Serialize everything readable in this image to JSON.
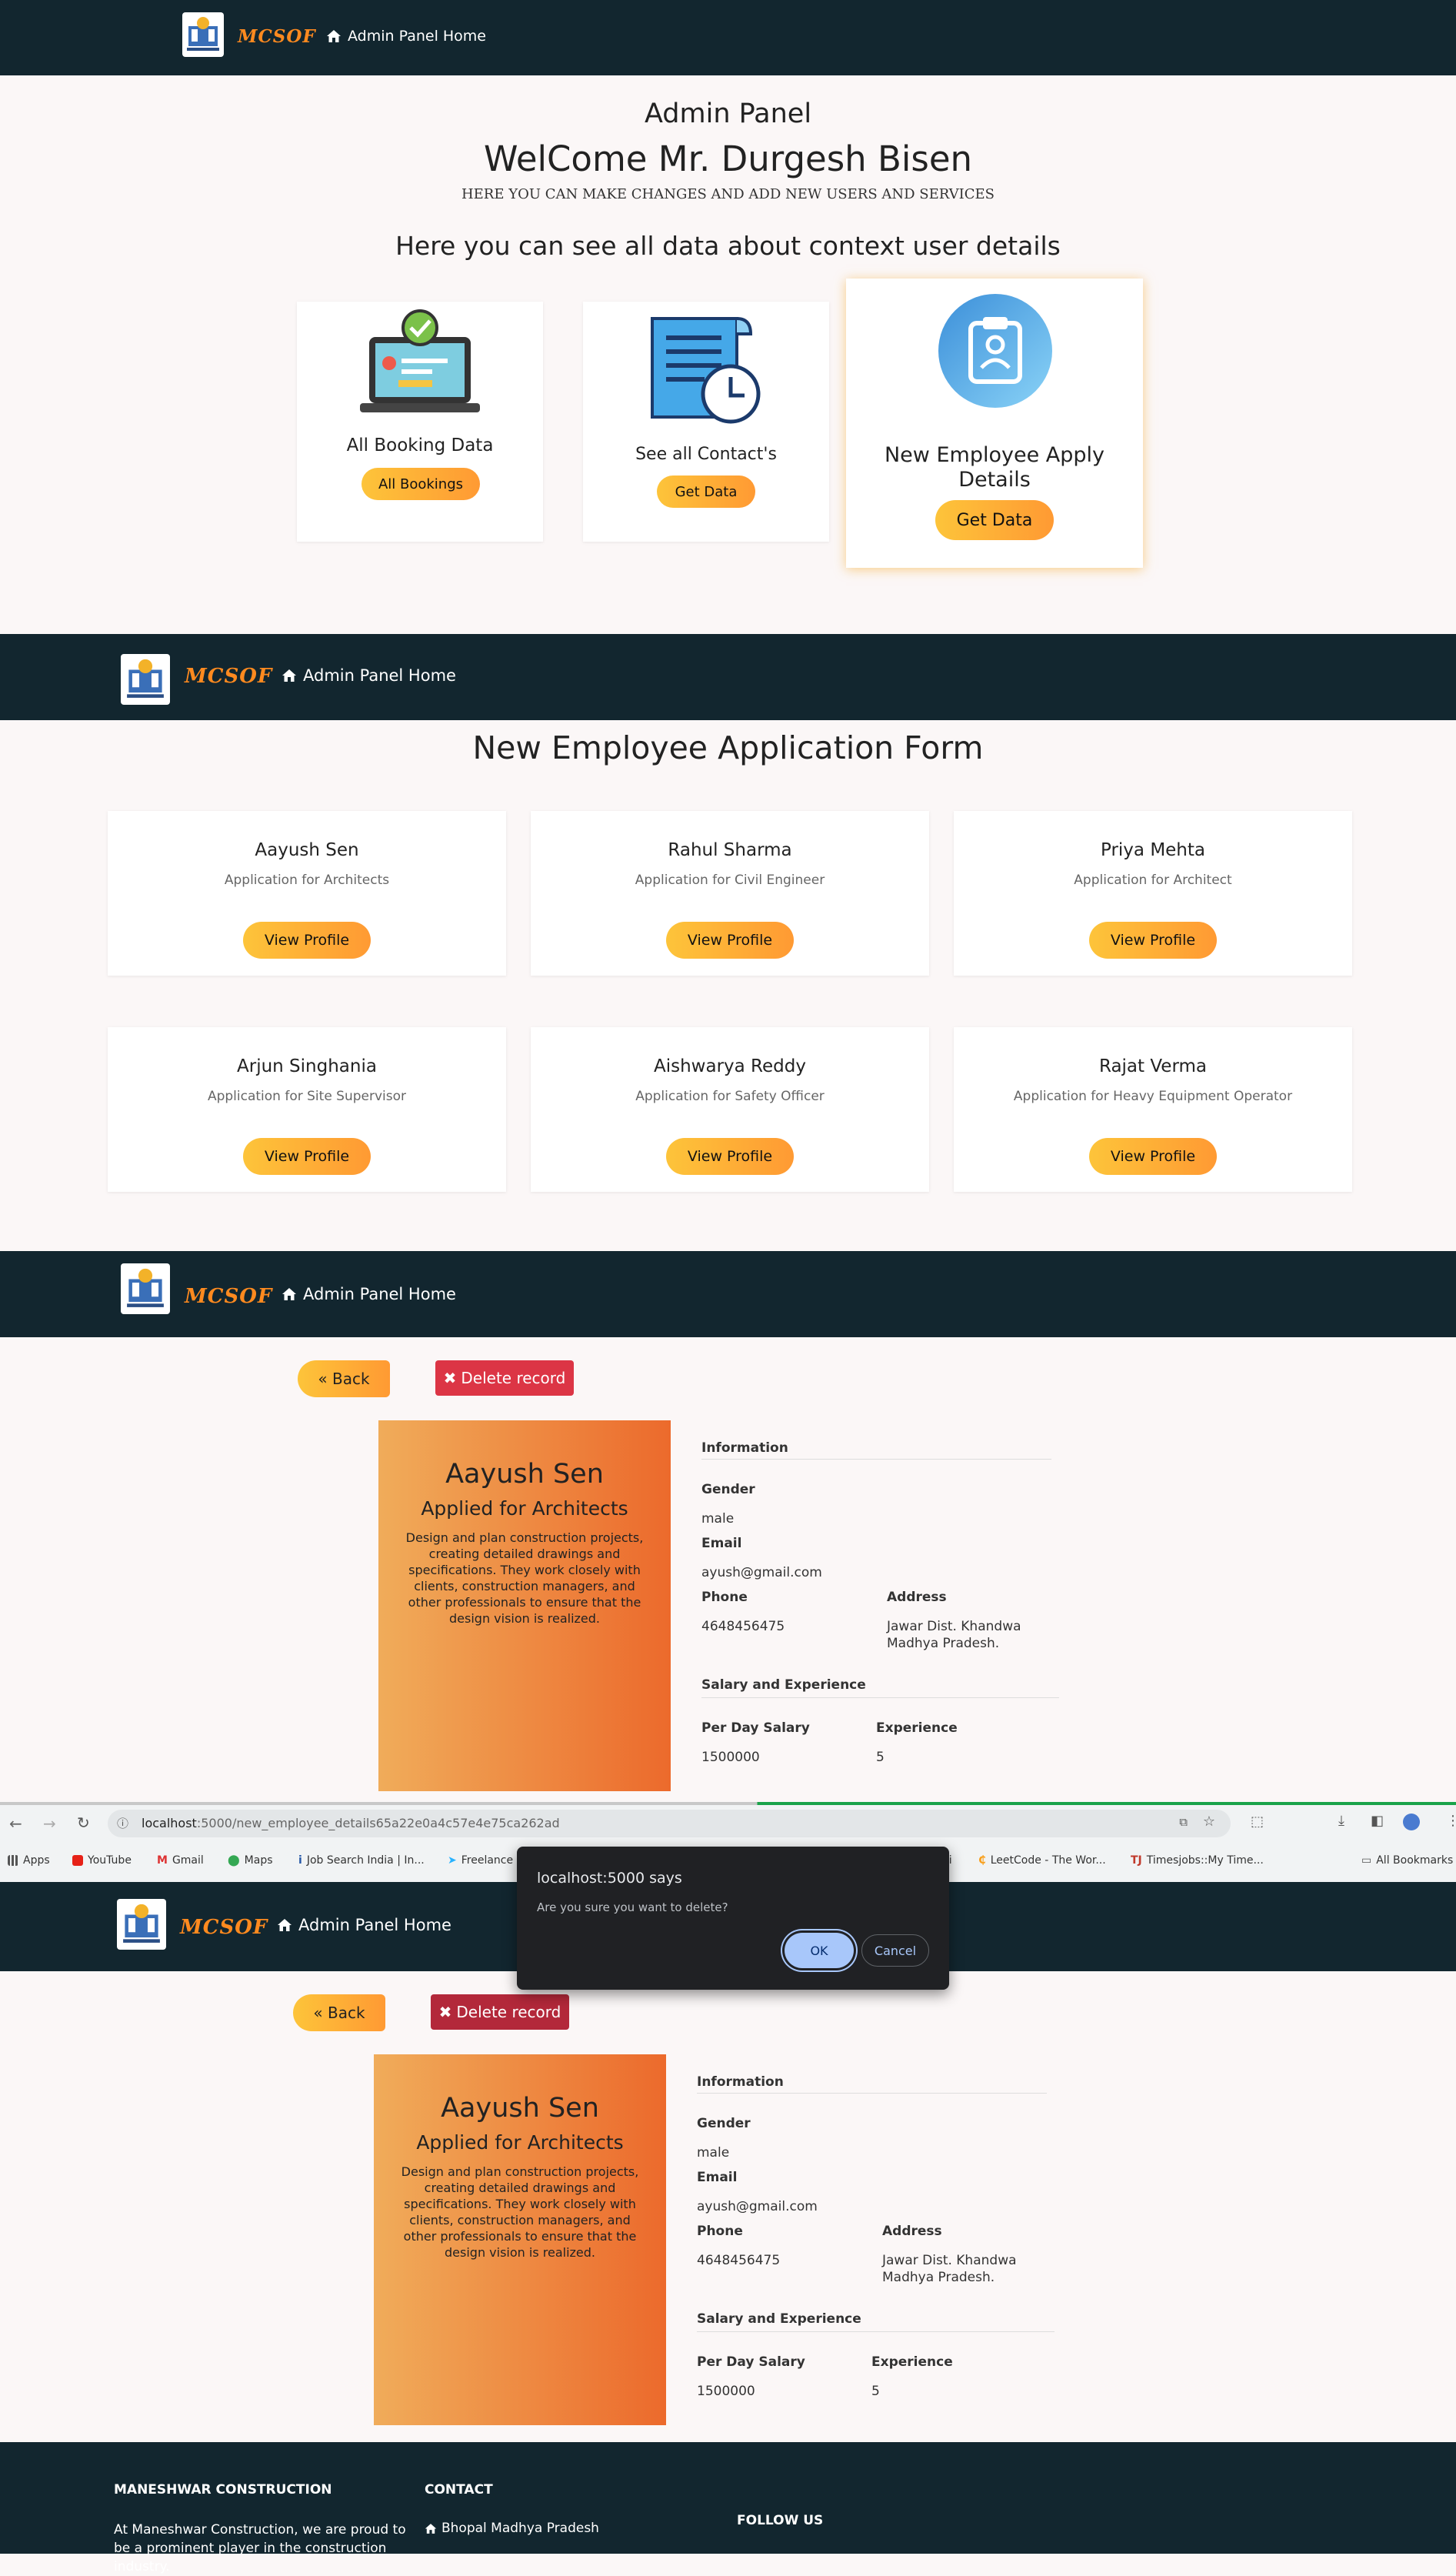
{
  "nav": {
    "brand": "MCSOF",
    "home_link": "Admin Panel Home"
  },
  "dashboard": {
    "title": "Admin Panel",
    "welcome": "WelCome Mr. Durgesh Bisen",
    "tagline": "HERE YOU CAN MAKE CHANGES AND ADD NEW USERS AND SERVICES",
    "section_heading": "Here you can see all data about context user details",
    "cards": [
      {
        "label": "All Booking Data",
        "button": "All Bookings",
        "icon": "laptop-check-icon"
      },
      {
        "label": "See all Contact's",
        "button": "Get Data",
        "icon": "document-clock-icon"
      },
      {
        "label": "New Employee Apply Details",
        "button": "Get Data",
        "icon": "clipboard-user-icon"
      }
    ]
  },
  "applications": {
    "title": "New Employee Application Form",
    "view_label": "View Profile",
    "items": [
      {
        "name": "Aayush Sen",
        "role": "Application for Architects"
      },
      {
        "name": "Rahul Sharma",
        "role": "Application for Civil Engineer"
      },
      {
        "name": "Priya Mehta",
        "role": "Application for Architect"
      },
      {
        "name": "Arjun Singhania",
        "role": "Application for Site Supervisor"
      },
      {
        "name": "Aishwarya Reddy",
        "role": "Application for Safety Officer"
      },
      {
        "name": "Rajat Verma",
        "role": "Application for Heavy Equipment Operator"
      }
    ]
  },
  "profile": {
    "back_label": "« Back",
    "delete_label": "Delete record",
    "name": "Aayush Sen",
    "applied_for": "Applied for Architects",
    "description": "Design and plan construction projects, creating detailed drawings and specifications. They work closely with clients, construction managers, and other professionals to ensure that the design vision is realized.",
    "info_heading": "Information",
    "gender_label": "Gender",
    "gender": "male",
    "email_label": "Email",
    "email": "ayush@gmail.com",
    "phone_label": "Phone",
    "phone": "4648456475",
    "address_label": "Address",
    "address_line1": "Jawar Dist. Khandwa",
    "address_line2": "Madhya Pradesh.",
    "salary_heading": "Salary and Experience",
    "salary_label": "Per Day Salary",
    "salary": "1500000",
    "experience_label": "Experience",
    "experience": "5"
  },
  "browser": {
    "url_host": "localhost",
    "url_path": ":5000/new_employee_details65a22e0a4c57e4e75ca262ad",
    "bookmarks": [
      "Apps",
      "YouTube",
      "Gmail",
      "Maps",
      "Job Search India | In...",
      "Freelance",
      "LeetCode - The Wor...",
      "Timesjobs::My Time..."
    ],
    "bookmark_partial": "ri",
    "all_bookmarks": "All Bookmarks"
  },
  "dialog": {
    "title": "localhost:5000 says",
    "message": "Are you sure you want to delete?",
    "ok": "OK",
    "cancel": "Cancel"
  },
  "footer": {
    "company_heading": "MANESHWAR CONSTRUCTION",
    "company_text": "At Maneshwar Construction, we are proud to be a prominent player in the construction industry.",
    "contact_heading": "CONTACT",
    "contact_location": "Bhopal Madhya Pradesh",
    "follow_heading": "FOLLOW US"
  }
}
